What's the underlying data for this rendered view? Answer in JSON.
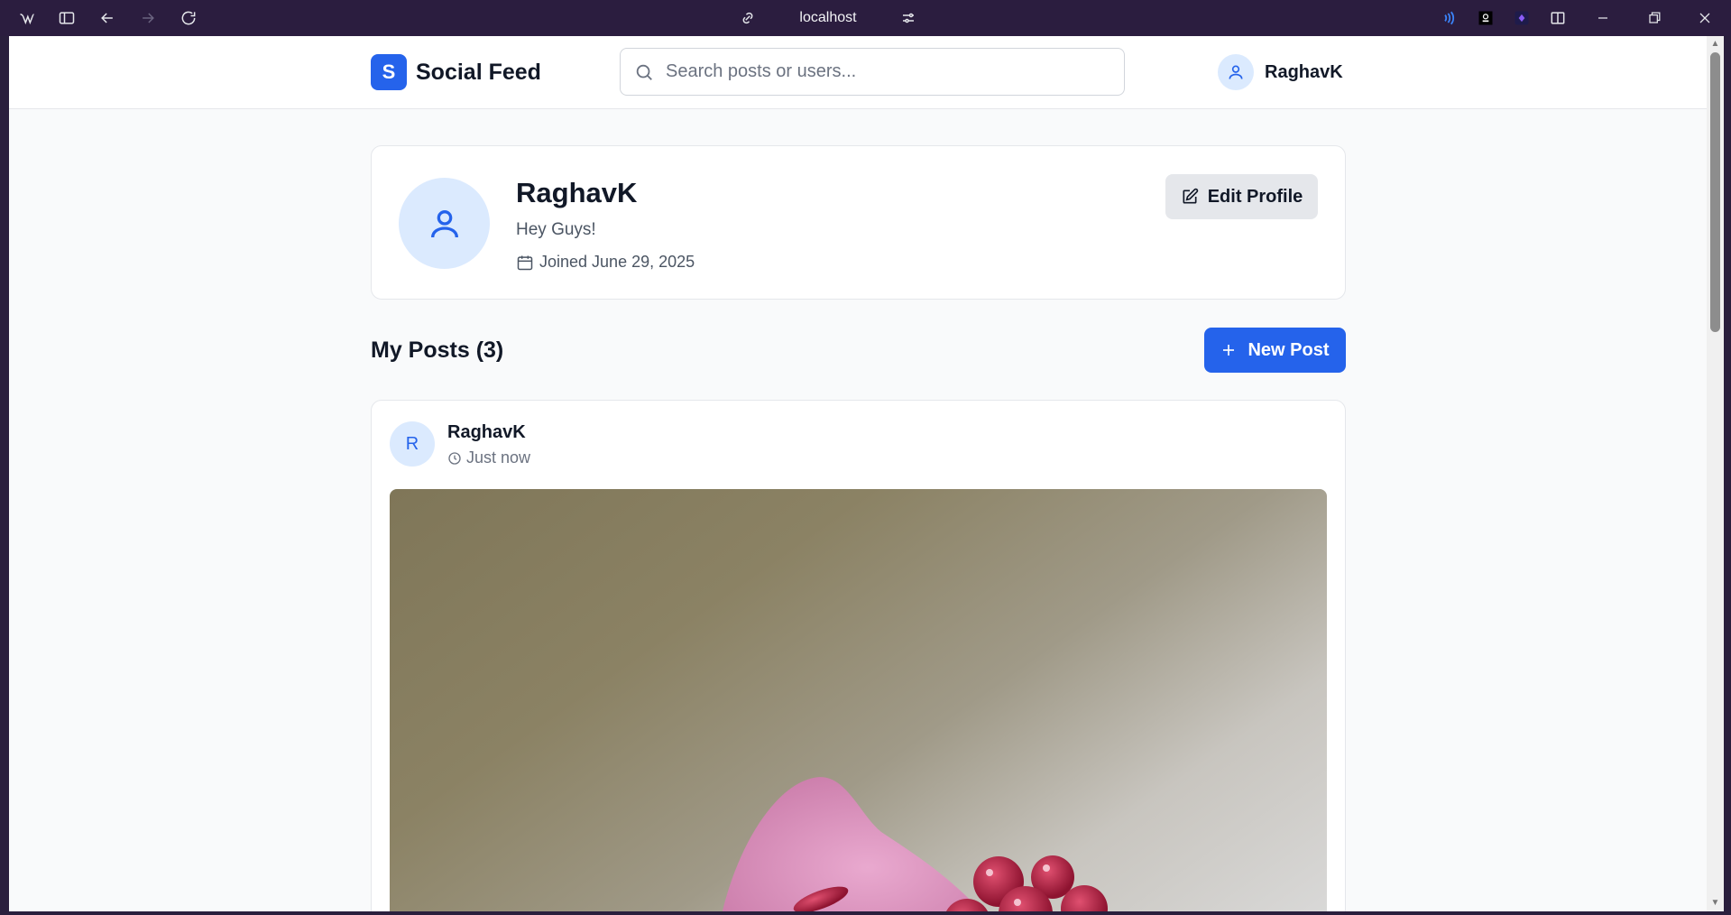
{
  "browser": {
    "address": "localhost"
  },
  "header": {
    "logo_letter": "S",
    "logo_text": "Social Feed",
    "search_placeholder": "Search posts or users...",
    "username": "RaghavK"
  },
  "profile": {
    "name": "RaghavK",
    "bio": "Hey Guys!",
    "joined": "Joined June 29, 2025",
    "edit_label": "Edit Profile"
  },
  "posts": {
    "title": "My Posts (3)",
    "new_post_label": "New Post",
    "items": [
      {
        "avatar_letter": "R",
        "author": "RaghavK",
        "time": "Just now"
      }
    ]
  },
  "colors": {
    "accent": "#2563eb",
    "avatar_bg": "#dbeafe",
    "page_bg": "#f9fafb"
  }
}
